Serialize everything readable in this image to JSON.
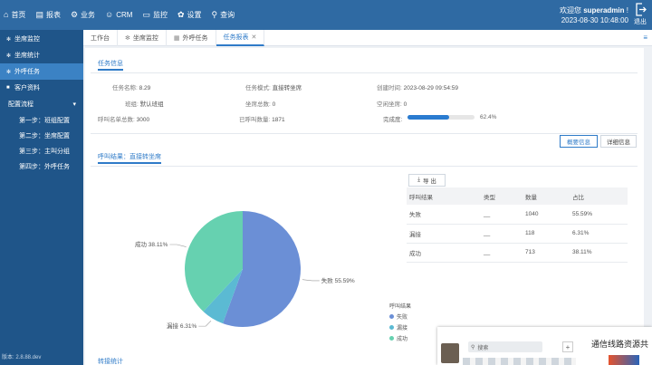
{
  "topnav": [
    {
      "icon": "home-icon",
      "glyph": "⌂",
      "label": "首页"
    },
    {
      "icon": "report-icon",
      "glyph": "▤",
      "label": "报表"
    },
    {
      "icon": "business-icon",
      "glyph": "⚙",
      "label": "业务"
    },
    {
      "icon": "crm-icon",
      "glyph": "☺",
      "label": "CRM"
    },
    {
      "icon": "monitor-icon",
      "glyph": "▭",
      "label": "监控"
    },
    {
      "icon": "settings-icon",
      "glyph": "✿",
      "label": "设置"
    },
    {
      "icon": "search-icon",
      "glyph": "⚲",
      "label": "查询"
    }
  ],
  "user": {
    "greeting": "欢迎您",
    "name": "superadmin",
    "suffix": "!",
    "datetime": "2023-08-30 10:48:00",
    "logout_label": "退出"
  },
  "sidebar": {
    "items": [
      {
        "label": "坐席监控"
      },
      {
        "label": "坐席统计"
      },
      {
        "label": "外呼任务"
      },
      {
        "label": "客户资料"
      }
    ],
    "group": {
      "label": "配置流程",
      "children": [
        "第一步：班组配置",
        "第二步：坐席配置",
        "第三步：主叫分组",
        "第四步：外呼任务"
      ]
    },
    "version": "版本: 2.8.88.dev"
  },
  "tabs": [
    {
      "label": "工作台"
    },
    {
      "label": "坐席监控"
    },
    {
      "label": "外呼任务"
    },
    {
      "label": "任务报表"
    }
  ],
  "info": {
    "section_title": "任务信息",
    "task_name_label": "任务名称:",
    "task_name": "8.29",
    "task_mode_label": "任务模式:",
    "task_mode": "直接转坐席",
    "created_label": "创建时间:",
    "created": "2023-08-29 09:54:59",
    "group_label": "班组:",
    "group": "默认班组",
    "agents_total_label": "坐席总数:",
    "agents_total": "0",
    "idle_agents_label": "空闲坐席:",
    "idle_agents": "0",
    "list_total_label": "呼叫名单总数:",
    "list_total": "3000",
    "called_label": "已呼叫数量:",
    "called": "1871",
    "completion_label": "完成度:",
    "completion": "62.4%",
    "completion_fraction": 0.624
  },
  "view_buttons": {
    "summary": "概要信息",
    "detail": "详细信息"
  },
  "result": {
    "section_title": "呼叫结果：直接转坐席",
    "export_label": "导 出",
    "columns": [
      "呼叫结果",
      "类型",
      "数量",
      "占比"
    ],
    "rows": [
      {
        "result": "失败",
        "type": "__",
        "count": "1040",
        "ratio": "55.59%"
      },
      {
        "result": "漏接",
        "type": "__",
        "count": "118",
        "ratio": "6.31%"
      },
      {
        "result": "成功",
        "type": "__",
        "count": "713",
        "ratio": "38.11%"
      }
    ]
  },
  "chart_data": {
    "type": "pie",
    "categories": [
      "失败",
      "漏接",
      "成功"
    ],
    "values": [
      55.59,
      6.31,
      38.11
    ],
    "labels": [
      "失败 55.59%",
      "漏接 6.31%",
      "成功 38.11%"
    ],
    "colors": [
      "#6b8fd6",
      "#5bbad3",
      "#66d1b0"
    ],
    "legend_title": "呼叫结果",
    "legend_position": "bottom-right"
  },
  "bottom_section_title": "转接统计",
  "popup": {
    "search_placeholder": "搜索",
    "title": "通信线路资源共"
  }
}
